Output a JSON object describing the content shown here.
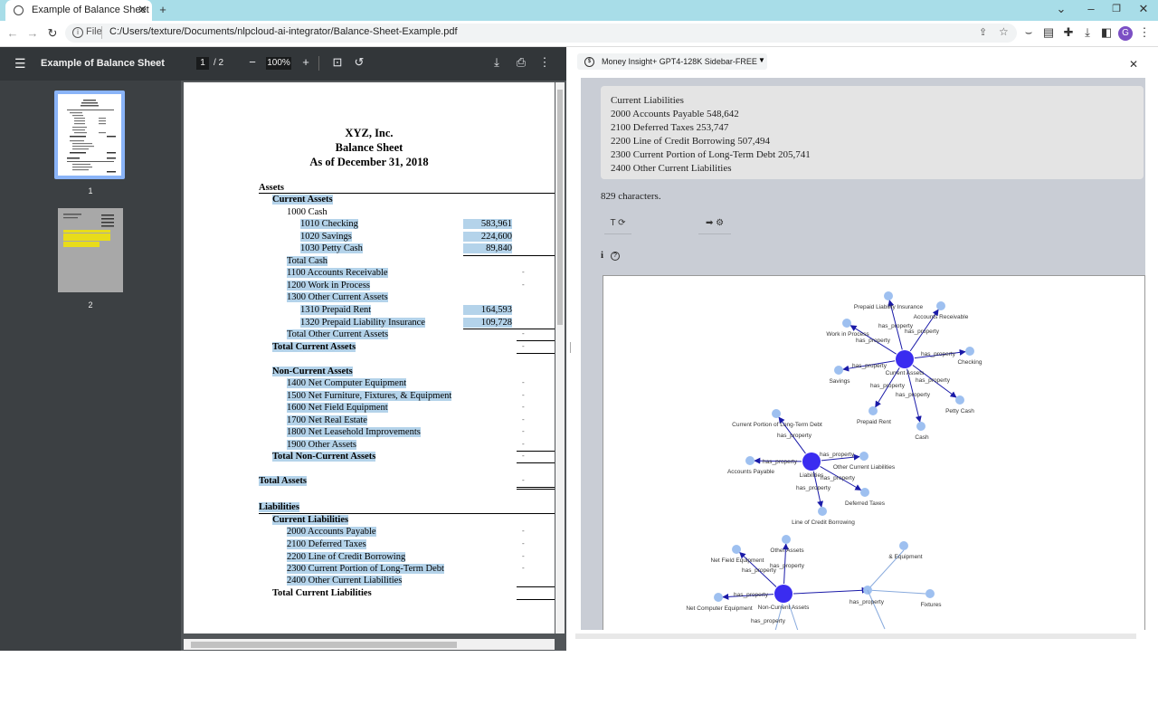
{
  "browser": {
    "tab_title": "Example of Balance Sheet",
    "file_label": "File",
    "url": "C:/Users/texture/Documents/nlpcloud-ai-integrator/Balance-Sheet-Example.pdf",
    "avatar_letter": "G"
  },
  "pdf_toolbar": {
    "title": "Example of Balance Sheet",
    "page_current": "1",
    "page_total": "/ 2",
    "zoom": "100%"
  },
  "thumbnails": [
    {
      "label": "1"
    },
    {
      "label": "2"
    }
  ],
  "document": {
    "company": "XYZ, Inc.",
    "title": "Balance Sheet",
    "date": "As of December 31, 2018",
    "assets": "Assets",
    "current_assets": "Current Assets",
    "cash": "1000 Cash",
    "checking": "1010 Checking",
    "checking_val": "583,961",
    "savings": "1020 Savings",
    "savings_val": "224,600",
    "petty": "1030 Petty Cash",
    "petty_val": "89,840",
    "total_cash": "Total Cash",
    "ar": "1100 Accounts Receivable",
    "wip": "1200 Work in Process",
    "oca": "1300 Other Current Assets",
    "prepaid_rent": "1310 Prepaid Rent",
    "prepaid_rent_val": "164,593",
    "prepaid_liab": "1320 Prepaid Liability Insurance",
    "prepaid_liab_val": "109,728",
    "total_oca": "Total Other Current Assets",
    "total_ca": "Total Current Assets",
    "nca": "Non-Current Assets",
    "computer": "1400 Net Computer Equipment",
    "furniture": "1500 Net Furniture, Fixtures, & Equipment",
    "field": "1600 Net Field Equipment",
    "real_estate": "1700 Net Real Estate",
    "leasehold": "1800 Net Leasehold Improvements",
    "other_assets": "1900 Other Assets",
    "total_nca": "Total Non-Current Assets",
    "total_assets": "Total Assets",
    "liabilities": "Liabilities",
    "current_liabilities": "Current Liabilities",
    "ap": "2000 Accounts Payable",
    "deferred": "2100 Deferred Taxes",
    "loc": "2200 Line of Credit Borrowing",
    "cpltd": "2300 Current Portion of Long-Term Debt",
    "ocl": "2400 Other Current Liabilities",
    "total_cl": "Total Current Liabilities",
    "dash": "-"
  },
  "sidebar": {
    "model_name": "Money Insight+ GPT4-128K Sidebar-FREE",
    "answer_lines": [
      "Current Liabilities",
      "2000 Accounts Payable 548,642",
      "2100 Deferred Taxes 253,747",
      "2200 Line of Credit Borrowing 507,494",
      "2300 Current Portion of Long-Term Debt 205,741",
      "2400 Other Current Liabilities"
    ],
    "char_count": "829 characters.",
    "btn_text": "T ⟳",
    "btn_arrow": "➡ ⚙",
    "info": "i",
    "help": "?"
  },
  "graph": {
    "edge_label": "has_property",
    "hubs": [
      {
        "id": "ca",
        "label": "Current Assets"
      },
      {
        "id": "li",
        "label": "Liabilities"
      },
      {
        "id": "nca",
        "label": "Non-Current Assets"
      }
    ],
    "leaves": [
      {
        "label": "Prepaid Liability Insurance",
        "hub": "ca"
      },
      {
        "label": "Accounts Receivable",
        "hub": "ca"
      },
      {
        "label": "Work in Process",
        "hub": "ca"
      },
      {
        "label": "Checking",
        "hub": "ca"
      },
      {
        "label": "Savings",
        "hub": "ca"
      },
      {
        "label": "Petty Cash",
        "hub": "ca"
      },
      {
        "label": "Prepaid Rent",
        "hub": "ca"
      },
      {
        "label": "Cash",
        "hub": "ca"
      },
      {
        "label": "Current Portion of Long-Term Debt",
        "hub": "li"
      },
      {
        "label": "Other Current Liabilities",
        "hub": "li"
      },
      {
        "label": "Accounts Payable",
        "hub": "li"
      },
      {
        "label": "Deferred Taxes",
        "hub": "li"
      },
      {
        "label": "Line of Credit Borrowing",
        "hub": "li"
      },
      {
        "label": "Other Assets",
        "hub": "nca"
      },
      {
        "label": "Net Field Equipment",
        "hub": "nca"
      },
      {
        "label": "Net Computer Equipment",
        "hub": "nca"
      },
      {
        "label": "& Equipment",
        "hub": "nca"
      },
      {
        "label": "Fixtures",
        "hub": "nca"
      }
    ]
  }
}
